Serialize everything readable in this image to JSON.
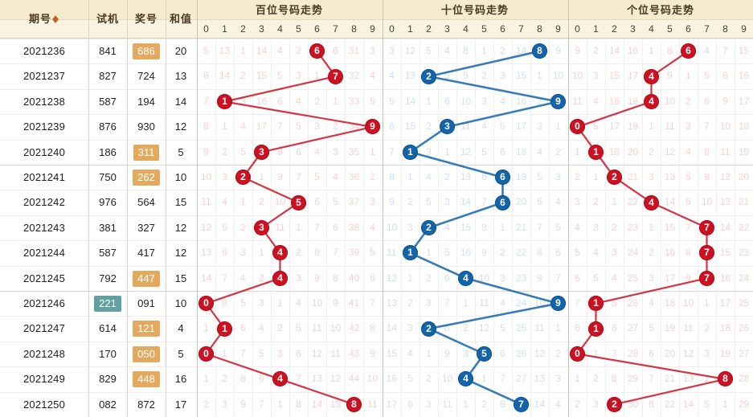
{
  "meta": {
    "colors": {
      "red": "#cc1122",
      "blue": "#1464aa",
      "header_bg": "#f6eccd",
      "highlight_orange": "#e3aa5f",
      "highlight_teal": "#63a0a2"
    }
  },
  "header": {
    "left_columns": [
      {
        "key": "period",
        "label": "期号",
        "sortable": true
      },
      {
        "key": "test",
        "label": "试机",
        "sortable": false
      },
      {
        "key": "prize",
        "label": "奖号",
        "sortable": false
      },
      {
        "key": "sum",
        "label": "和值",
        "sortable": false
      }
    ],
    "sections": [
      {
        "key": "hundreds",
        "title": "百位号码走势",
        "color": "red"
      },
      {
        "key": "tens",
        "title": "十位号码走势",
        "color": "blue"
      },
      {
        "key": "units",
        "title": "个位号码走势",
        "color": "red"
      }
    ],
    "digit_headers": [
      "0",
      "1",
      "2",
      "3",
      "4",
      "5",
      "6",
      "7",
      "8",
      "9"
    ]
  },
  "rows": [
    {
      "period": "2021236",
      "test": "841",
      "prize": "686",
      "prize_hl": "orange",
      "sum": "20",
      "hundreds": {
        "hit": 6,
        "miss": [
          "5",
          "13",
          "1",
          "14",
          "4",
          "2",
          "",
          "6",
          "31",
          "3"
        ]
      },
      "tens": {
        "hit": 8,
        "miss": [
          "3",
          "12",
          "5",
          "4",
          "8",
          "1",
          "2",
          "14",
          "",
          "9"
        ]
      },
      "units": {
        "hit": 6,
        "miss": [
          "9",
          "2",
          "14",
          "16",
          "1",
          "8",
          "",
          "4",
          "7",
          "15"
        ]
      }
    },
    {
      "period": "2021237",
      "test": "827",
      "prize": "724",
      "prize_hl": "none",
      "sum": "13",
      "hundreds": {
        "hit": 7,
        "miss": [
          "6",
          "14",
          "2",
          "15",
          "5",
          "3",
          "1",
          "",
          "32",
          "4"
        ]
      },
      "tens": {
        "hit": 2,
        "miss": [
          "4",
          "13",
          "",
          "5",
          "9",
          "2",
          "3",
          "15",
          "1",
          "10"
        ]
      },
      "units": {
        "hit": 4,
        "miss": [
          "10",
          "3",
          "15",
          "17",
          "",
          "9",
          "1",
          "5",
          "8",
          "16"
        ]
      }
    },
    {
      "period": "2021238",
      "test": "587",
      "prize": "194",
      "prize_hl": "none",
      "sum": "14",
      "hundreds": {
        "hit": 1,
        "miss": [
          "7",
          "",
          "3",
          "16",
          "6",
          "4",
          "2",
          "1",
          "33",
          "5"
        ]
      },
      "tens": {
        "hit": 9,
        "miss": [
          "5",
          "14",
          "1",
          "6",
          "10",
          "3",
          "4",
          "16",
          "2",
          ""
        ]
      },
      "units": {
        "hit": 4,
        "miss": [
          "11",
          "4",
          "16",
          "18",
          "",
          "10",
          "2",
          "6",
          "9",
          "17"
        ]
      }
    },
    {
      "period": "2021239",
      "test": "876",
      "prize": "930",
      "prize_hl": "none",
      "sum": "12",
      "hundreds": {
        "hit": 9,
        "miss": [
          "8",
          "1",
          "4",
          "17",
          "7",
          "5",
          "3",
          "2",
          "34",
          ""
        ]
      },
      "tens": {
        "hit": 3,
        "miss": [
          "6",
          "15",
          "2",
          "",
          "11",
          "4",
          "5",
          "17",
          "3",
          "1"
        ]
      },
      "units": {
        "hit": 0,
        "miss": [
          "",
          "5",
          "17",
          "19",
          "1",
          "11",
          "3",
          "7",
          "10",
          "18"
        ]
      }
    },
    {
      "period": "2021240",
      "test": "186",
      "prize": "311",
      "prize_hl": "orange",
      "sum": "5",
      "hundreds": {
        "hit": 3,
        "miss": [
          "9",
          "2",
          "5",
          "",
          "8",
          "6",
          "4",
          "3",
          "35",
          "1"
        ]
      },
      "tens": {
        "hit": 1,
        "miss": [
          "7",
          "",
          "3",
          "1",
          "12",
          "5",
          "6",
          "18",
          "4",
          "2"
        ]
      },
      "units": {
        "hit": 1,
        "miss": [
          "1",
          "",
          "18",
          "20",
          "2",
          "12",
          "4",
          "8",
          "11",
          "19"
        ]
      }
    },
    {
      "period": "2021241",
      "test": "750",
      "prize": "262",
      "prize_hl": "orange",
      "sum": "10",
      "hundreds": {
        "hit": 2,
        "miss": [
          "10",
          "3",
          "",
          "1",
          "9",
          "7",
          "5",
          "4",
          "36",
          "2"
        ]
      },
      "tens": {
        "hit": 6,
        "miss": [
          "8",
          "1",
          "4",
          "2",
          "13",
          "6",
          "",
          "19",
          "5",
          "3"
        ]
      },
      "units": {
        "hit": 2,
        "miss": [
          "2",
          "1",
          "",
          "21",
          "3",
          "13",
          "5",
          "9",
          "12",
          "20"
        ]
      }
    },
    {
      "period": "2021242",
      "test": "976",
      "prize": "564",
      "prize_hl": "none",
      "sum": "15",
      "hundreds": {
        "hit": 5,
        "miss": [
          "11",
          "4",
          "1",
          "2",
          "10",
          "",
          "6",
          "5",
          "37",
          "3"
        ]
      },
      "tens": {
        "hit": 6,
        "miss": [
          "9",
          "2",
          "5",
          "3",
          "14",
          "7",
          "",
          "20",
          "6",
          "4"
        ]
      },
      "units": {
        "hit": 4,
        "miss": [
          "3",
          "2",
          "1",
          "22",
          "",
          "14",
          "6",
          "10",
          "13",
          "21"
        ]
      }
    },
    {
      "period": "2021243",
      "test": "381",
      "prize": "327",
      "prize_hl": "none",
      "sum": "12",
      "hundreds": {
        "hit": 3,
        "miss": [
          "12",
          "5",
          "2",
          "",
          "11",
          "1",
          "7",
          "6",
          "38",
          "4"
        ]
      },
      "tens": {
        "hit": 2,
        "miss": [
          "10",
          "3",
          "",
          "4",
          "15",
          "8",
          "1",
          "21",
          "7",
          "5"
        ]
      },
      "units": {
        "hit": 7,
        "miss": [
          "4",
          "3",
          "2",
          "23",
          "1",
          "15",
          "7",
          "",
          "14",
          "22"
        ]
      }
    },
    {
      "period": "2021244",
      "test": "587",
      "prize": "417",
      "prize_hl": "none",
      "sum": "12",
      "hundreds": {
        "hit": 4,
        "miss": [
          "13",
          "6",
          "3",
          "1",
          "",
          "2",
          "8",
          "7",
          "39",
          "5"
        ]
      },
      "tens": {
        "hit": 1,
        "miss": [
          "11",
          "",
          "1",
          "5",
          "16",
          "9",
          "2",
          "22",
          "8",
          "6"
        ]
      },
      "units": {
        "hit": 7,
        "miss": [
          "5",
          "4",
          "3",
          "24",
          "2",
          "16",
          "8",
          "",
          "15",
          "23"
        ]
      }
    },
    {
      "period": "2021245",
      "test": "792",
      "prize": "447",
      "prize_hl": "orange",
      "sum": "15",
      "hundreds": {
        "hit": 4,
        "miss": [
          "14",
          "7",
          "4",
          "2",
          "",
          "3",
          "9",
          "8",
          "40",
          "6"
        ]
      },
      "tens": {
        "hit": 4,
        "miss": [
          "12",
          "1",
          "2",
          "6",
          "",
          "10",
          "3",
          "23",
          "9",
          "7"
        ]
      },
      "units": {
        "hit": 7,
        "miss": [
          "6",
          "5",
          "4",
          "25",
          "3",
          "17",
          "9",
          "",
          "16",
          "24"
        ]
      }
    },
    {
      "period": "2021246",
      "test": "221",
      "test_hl": "teal",
      "prize": "091",
      "prize_hl": "none",
      "sum": "10",
      "hundreds": {
        "hit": 0,
        "miss": [
          "",
          "8",
          "5",
          "3",
          "1",
          "4",
          "10",
          "9",
          "41",
          "7"
        ]
      },
      "tens": {
        "hit": 9,
        "miss": [
          "13",
          "2",
          "3",
          "7",
          "1",
          "11",
          "4",
          "24",
          "10",
          ""
        ]
      },
      "units": {
        "hit": 1,
        "miss": [
          "7",
          "",
          "5",
          "26",
          "4",
          "18",
          "10",
          "1",
          "17",
          "25"
        ]
      }
    },
    {
      "period": "2021247",
      "test": "614",
      "prize": "121",
      "prize_hl": "orange",
      "sum": "4",
      "hundreds": {
        "hit": 1,
        "miss": [
          "1",
          "",
          "6",
          "4",
          "2",
          "5",
          "11",
          "10",
          "42",
          "8"
        ]
      },
      "tens": {
        "hit": 2,
        "miss": [
          "14",
          "3",
          "",
          "8",
          "2",
          "12",
          "5",
          "25",
          "11",
          "1"
        ]
      },
      "units": {
        "hit": 1,
        "miss": [
          "8",
          "",
          "6",
          "27",
          "5",
          "19",
          "11",
          "2",
          "18",
          "26"
        ]
      }
    },
    {
      "period": "2021248",
      "test": "170",
      "prize": "050",
      "prize_hl": "orange",
      "sum": "5",
      "hundreds": {
        "hit": 0,
        "miss": [
          "",
          "1",
          "7",
          "5",
          "3",
          "6",
          "12",
          "11",
          "43",
          "9"
        ]
      },
      "tens": {
        "hit": 5,
        "miss": [
          "15",
          "4",
          "1",
          "9",
          "3",
          "",
          "6",
          "26",
          "12",
          "2"
        ]
      },
      "units": {
        "hit": 0,
        "miss": [
          "",
          "1",
          "7",
          "28",
          "6",
          "20",
          "12",
          "3",
          "19",
          "27"
        ]
      }
    },
    {
      "period": "2021249",
      "test": "829",
      "prize": "448",
      "prize_hl": "orange",
      "sum": "16",
      "hundreds": {
        "hit": 4,
        "miss": [
          "1",
          "2",
          "8",
          "6",
          "",
          "7",
          "13",
          "12",
          "44",
          "10"
        ]
      },
      "tens": {
        "hit": 4,
        "miss": [
          "16",
          "5",
          "2",
          "10",
          "",
          "1",
          "7",
          "27",
          "13",
          "3"
        ]
      },
      "units": {
        "hit": 8,
        "miss": [
          "1",
          "2",
          "8",
          "29",
          "7",
          "21",
          "13",
          "1",
          "",
          "28"
        ]
      }
    },
    {
      "period": "2021250",
      "test": "082",
      "prize": "872",
      "prize_hl": "none",
      "sum": "17",
      "hundreds": {
        "hit": 8,
        "miss": [
          "2",
          "3",
          "9",
          "7",
          "1",
          "8",
          "14",
          "13",
          "",
          "11"
        ]
      },
      "tens": {
        "hit": 7,
        "miss": [
          "17",
          "6",
          "3",
          "11",
          "1",
          "2",
          "8",
          "",
          "14",
          "4"
        ]
      },
      "units": {
        "hit": 2,
        "miss": [
          "2",
          "3",
          "",
          "30",
          "8",
          "22",
          "14",
          "5",
          "1",
          "29"
        ]
      }
    }
  ]
}
